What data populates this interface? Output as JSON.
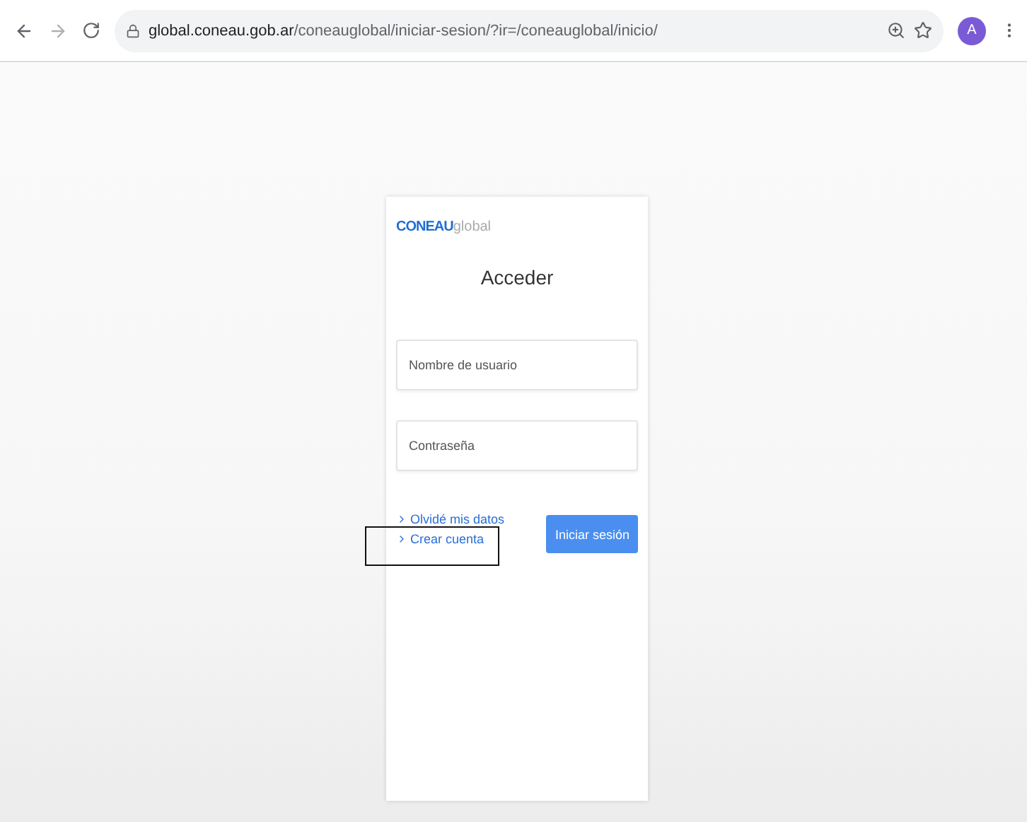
{
  "browser": {
    "url_host": "global.coneau.gob.ar",
    "url_path": "/coneauglobal/iniciar-sesion/?ir=/coneauglobal/inicio/",
    "avatar": "A"
  },
  "login": {
    "logo": {
      "brand": "CONEAU",
      "suffix": "global"
    },
    "title": "Acceder",
    "fields": [
      {
        "placeholder": "Nombre de usuario"
      },
      {
        "placeholder": "Contraseña"
      }
    ],
    "links": [
      {
        "label": "Olvidé mis datos",
        "highlighted": false
      },
      {
        "label": "Crear cuenta",
        "highlighted": true
      }
    ],
    "submit": "Iniciar sesión"
  }
}
